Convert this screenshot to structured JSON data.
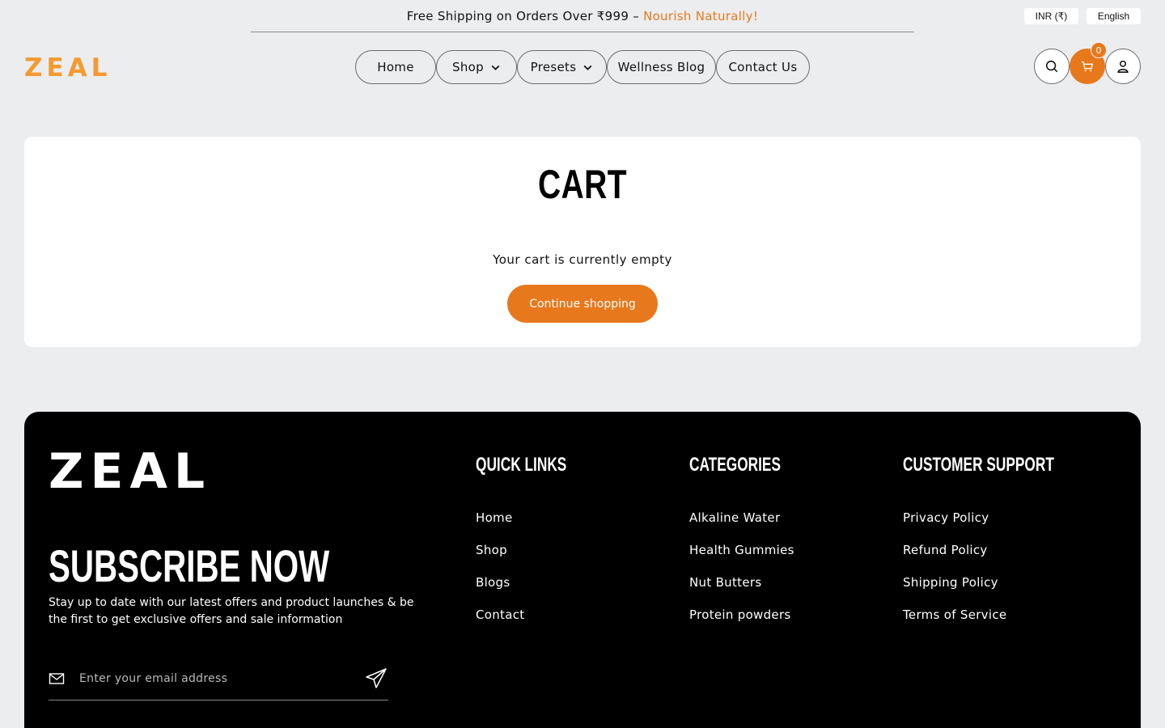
{
  "announcement": {
    "text": "Free Shipping on Orders Over ₹999 –",
    "accent": "Nourish Naturally!"
  },
  "selectors": {
    "currency": "INR (₹)",
    "language": "English"
  },
  "header": {
    "logo": "ZEAL",
    "nav": [
      {
        "label": "Home"
      },
      {
        "label": "Shop"
      },
      {
        "label": "Presets"
      },
      {
        "label": "Wellness Blog"
      },
      {
        "label": "Contact Us"
      }
    ],
    "cart_count": "0"
  },
  "cart": {
    "title": "CART",
    "empty_message": "Your cart is currently empty",
    "continue_label": "Continue shopping"
  },
  "footer": {
    "logo": "ZEAL",
    "subscribe_title": "SUBSCRIBE NOW",
    "subscribe_desc": "Stay up to date with our latest offers and product launches & be the first to get exclusive offers and sale information",
    "email_placeholder": "Enter your email address",
    "quick_links": {
      "title": "QUICK LINKS",
      "items": [
        "Home",
        "Shop",
        "Blogs",
        "Contact"
      ]
    },
    "categories": {
      "title": "CATEGORIES",
      "items": [
        "Alkaline Water",
        "Health Gummies",
        "Nut Butters",
        "Protein powders"
      ]
    },
    "support": {
      "title": "CUSTOMER SUPPORT",
      "items": [
        "Privacy Policy",
        "Refund Policy",
        "Shipping Policy",
        "Terms of Service"
      ]
    }
  },
  "colors": {
    "accent": "#e8781c",
    "logo": "#f59a2f",
    "background": "#ecedef",
    "footer": "#000000"
  }
}
